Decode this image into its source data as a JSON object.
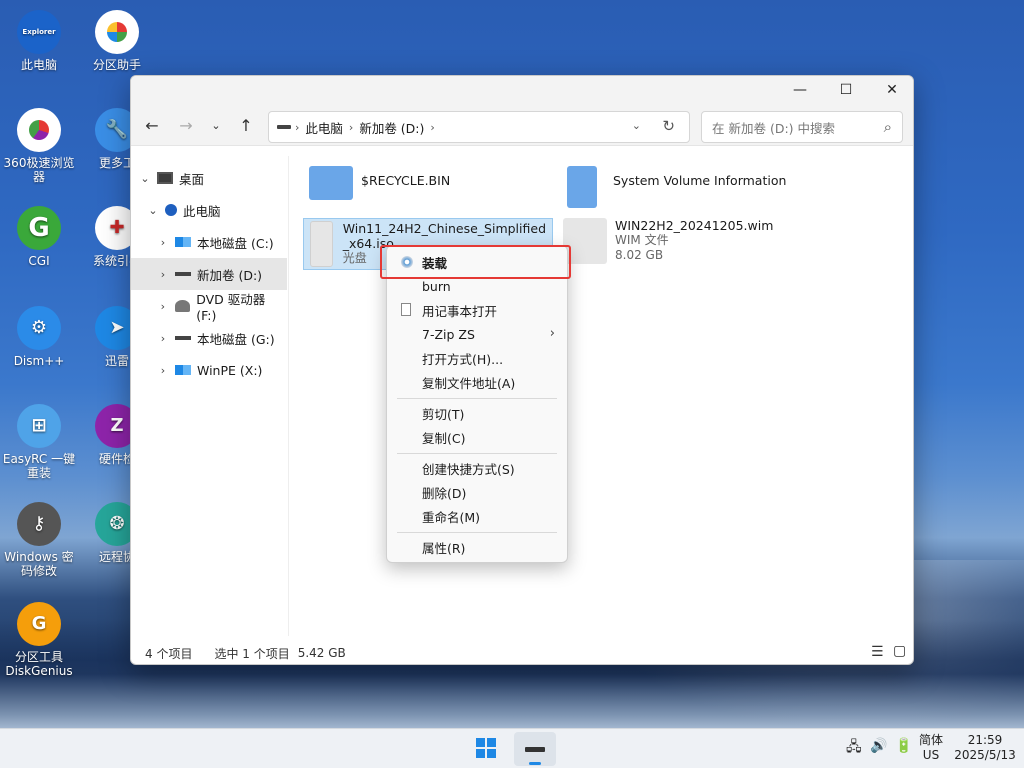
{
  "desktop": {
    "icons": [
      {
        "label": "此电脑",
        "badge": "Explorer"
      },
      {
        "label": "分区助手"
      },
      {
        "label": "360极速浏览器"
      },
      {
        "label": "更多工"
      },
      {
        "label": "CGI"
      },
      {
        "label": "系统引导"
      },
      {
        "label": "Dism++"
      },
      {
        "label": "迅雷"
      },
      {
        "label": "EasyRC 一键重装"
      },
      {
        "label": "硬件检"
      },
      {
        "label": "Windows 密码修改"
      },
      {
        "label": "远程协"
      },
      {
        "label": "分区工具 DiskGenius"
      }
    ]
  },
  "window": {
    "controls": {
      "minimize": "—",
      "maximize": "☐",
      "close": "✕"
    },
    "address": {
      "root": "此电脑",
      "current": "新加卷 (D:)"
    },
    "search": {
      "placeholder": "在 新加卷 (D:) 中搜索"
    },
    "sidebar": {
      "items": [
        {
          "label": "桌面"
        },
        {
          "label": "此电脑"
        },
        {
          "label": "本地磁盘 (C:)"
        },
        {
          "label": "新加卷 (D:)"
        },
        {
          "label": "DVD 驱动器 (F:)"
        },
        {
          "label": "本地磁盘 (G:)"
        },
        {
          "label": "WinPE (X:)"
        }
      ]
    },
    "files": [
      {
        "name": "$RECYCLE.BIN"
      },
      {
        "name": "System Volume Information"
      },
      {
        "name1": "Win11_24H2_Chinese_Simplified",
        "name2": "_x64.iso",
        "type": "光盘"
      },
      {
        "name": "WIN22H2_20241205.wim",
        "type": "WIM 文件",
        "size": "8.02 GB"
      }
    ],
    "status": {
      "count": "4 个项目",
      "selection": "选中 1 个项目",
      "size": "5.42 GB"
    }
  },
  "context_menu": {
    "items": [
      {
        "label": "装载"
      },
      {
        "label": "burn"
      },
      {
        "label": "用记事本打开"
      },
      {
        "label": "7-Zip ZS"
      },
      {
        "label": "打开方式(H)..."
      },
      {
        "label": "复制文件地址(A)"
      },
      {
        "label": "剪切(T)"
      },
      {
        "label": "复制(C)"
      },
      {
        "label": "创建快捷方式(S)"
      },
      {
        "label": "删除(D)"
      },
      {
        "label": "重命名(M)"
      },
      {
        "label": "属性(R)"
      }
    ]
  },
  "taskbar": {
    "ime": "简体",
    "locale": "US",
    "time": "21:59",
    "date": "2025/5/13"
  },
  "colors": {
    "accent": "#0067c0",
    "selection": "#cce4f7",
    "highlight_box": "#e53935"
  }
}
